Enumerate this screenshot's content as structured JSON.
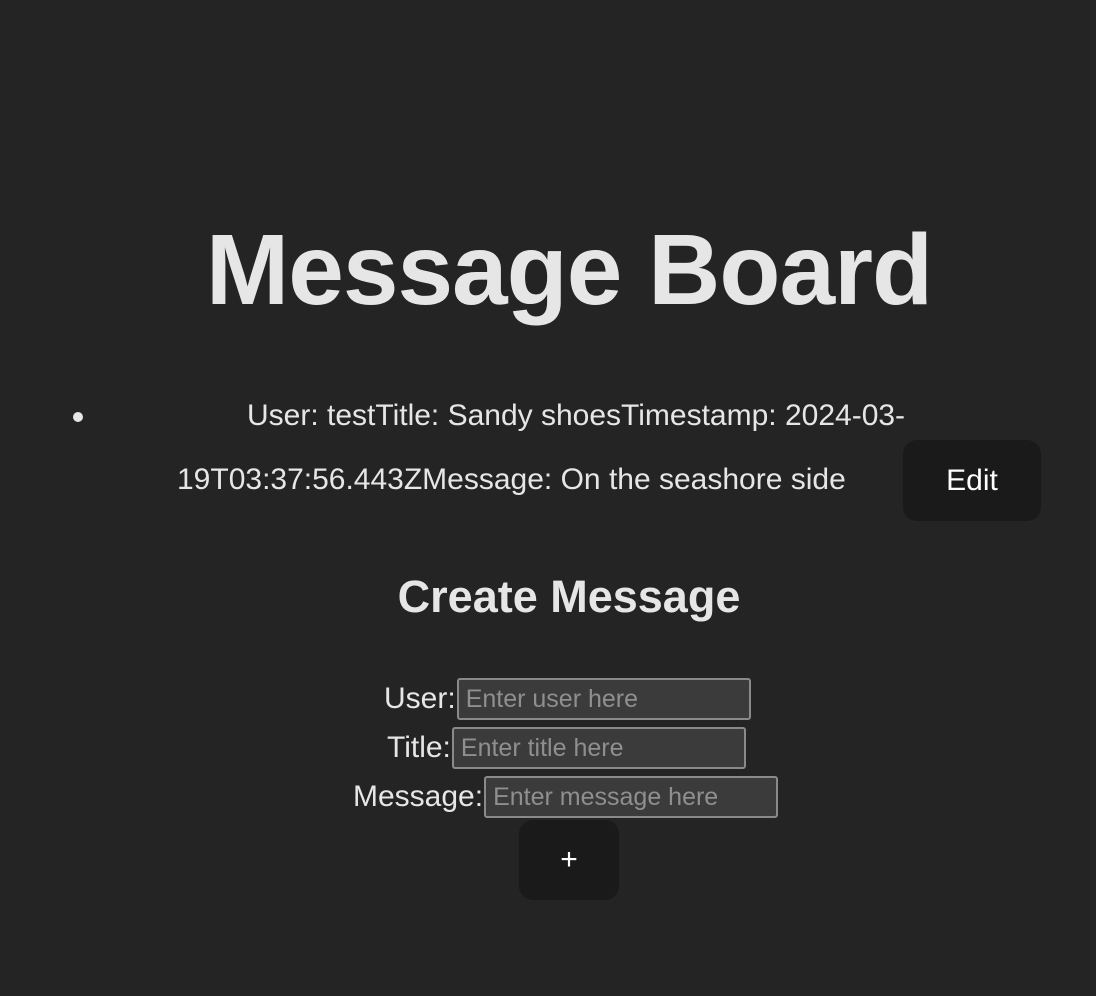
{
  "board": {
    "title": "Message Board"
  },
  "messages": [
    {
      "line1": "User: testTitle: Sandy shoesTimestamp: 2024-03-",
      "line2": "19T03:37:56.443ZMessage: On the seashore side",
      "edit_label": "Edit"
    }
  ],
  "create": {
    "title": "Create Message",
    "user_label": "User:",
    "user_placeholder": "Enter user here",
    "title_label": "Title:",
    "title_placeholder": "Enter title here",
    "message_label": "Message:",
    "message_placeholder": "Enter message here",
    "add_label": "+"
  }
}
